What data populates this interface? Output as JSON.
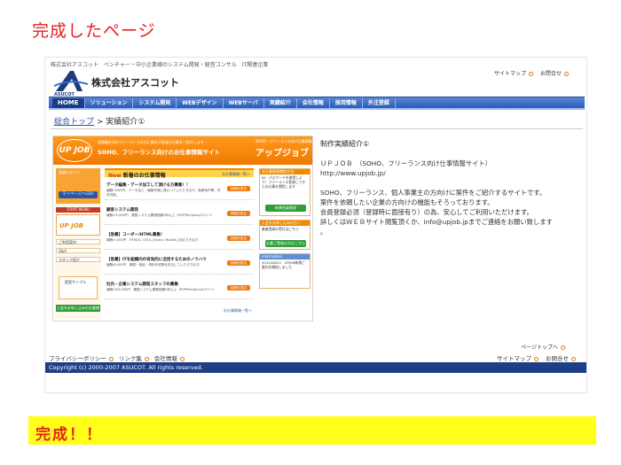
{
  "slide": {
    "title": "完成したページ",
    "done": "完成！！"
  },
  "site": {
    "topbar": "株式会社アスコット　ベンチャー・中小企業様のシステム開発・経営コンサル　IT関連企業",
    "company": "株式会社アスコット",
    "logo_sub": "ASUCOT",
    "toplinks": [
      "サイトマップ",
      "お問合せ"
    ],
    "nav": [
      "HOME",
      "ソリューション",
      "システム開発",
      "WEBデザイン",
      "WEBサーバ",
      "実績紹介",
      "会社情報",
      "採用情報",
      "外注登録"
    ],
    "breadcrumb": {
      "home": "総合トップ",
      "sep": " > ",
      "current": "実績紹介①"
    },
    "content": {
      "title": "制作実績紹介①",
      "line1": "ＵＰＪＯＢ　（SOHO、フリーランス向け仕事情報サイト）",
      "line2": "http://www.upjob.jp/",
      "line3": "SOHO、フリーランス、個人事業主の方向けに案件をご紹介するサイトです。",
      "line4": "案件を依頼したい企業の方向けの機能もそろっております。",
      "line5": "会員登録必須（登録時に面接有り）の為、安心してご利用いただけます。",
      "line6": "詳しくはＷＥＢサイト閲覧頂くか、info@upjob.jpまでご連絡をお願い致します",
      "line7": "。"
    },
    "pagetop": "ページトップへ",
    "footer_links": [
      "プライバシーポリシー",
      "リンク集",
      "会社情報"
    ],
    "footer_right": [
      "サイトマップ",
      "お問合せ"
    ],
    "copyright": "Copyright (c) 2000-2007 ASUCOT. All rights reserved."
  },
  "thumb": {
    "logo": "UP JOB",
    "tag": "首都圏在住のフリーランスの方に弊社が直接お仕事をご紹介します",
    "title": "SOHO、フリーランス向けのお仕事情報サイト",
    "brand": "アップジョブ",
    "brand_sub": "SOHO・フリーランス向け仕事情報",
    "login_label": "会員ログイン",
    "mypage": "マイページへGO!",
    "start": "START MENU",
    "side_items": [
      "ご利用案内",
      "Q&A",
      "スタッフ紹介"
    ],
    "sample": "提案サンプル",
    "entry": "入会をお申し込みの企業様",
    "new_head_prefix": "New",
    "new_head": "新着のお仕事情報",
    "list_link": "お仕事情報一覧へ",
    "jobs": [
      {
        "title": "データ編集・データ加工して頂ける方募集！！",
        "desc": "報酬:3000円　データ加工・編集作業に携わっていただきます。勤務地不問、在宅可能。",
        "btn": "詳細を見る"
      },
      {
        "title": "顧客システム開発",
        "desc": "報酬:25,000円　業務システム開発経験3年以上（PHP/Perl/Java/C/C++）",
        "btn": "詳細を見る"
      },
      {
        "title": "【急募】コーダー/HTML募集！",
        "desc": "報酬:5,000円　HTML5, CSS3, jQuery, Mobileに対応できる方",
        "btn": "詳細を見る"
      },
      {
        "title": "【急募】ITを組織内の有効的に活用するためのノウハウ",
        "desc": "報酬:8,000円　構想・検証・資料作成等を担当していただきます。",
        "btn": "詳細を見る"
      },
      {
        "title": "社内・企業システム開発スタッフの募集",
        "desc": "報酬:200,000円　業務システム開発経験3年以上（PHP/Perl/Java/C/C++）",
        "btn": "詳細を見る"
      }
    ],
    "right": {
      "head1": "お仕事情報閲覧方法",
      "txt1": "ID・パスワードを取得しよう！フリーランス登録してからお仕事を閲覧します",
      "green1": "新規会員登録",
      "head2": "入会をお申し込みの方へ",
      "txt2": "業者登録の受付はこちら",
      "green2": "企業ご登録の方はこちら",
      "head3": "information",
      "txt3": "2012/08/22　UPJOB新規ご案内を開始しました"
    }
  }
}
